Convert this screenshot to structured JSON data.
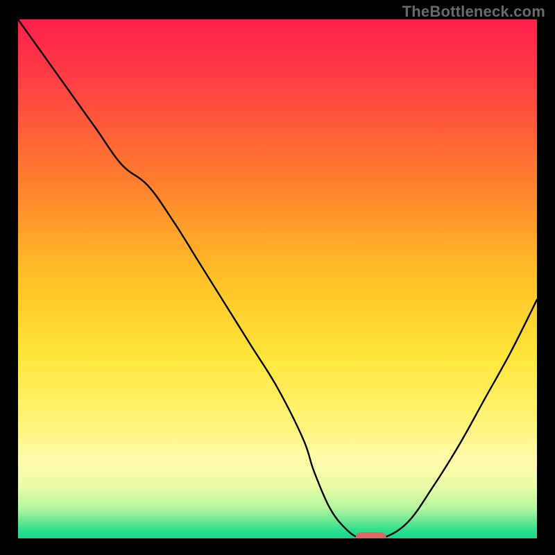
{
  "watermark": "TheBottleneck.com",
  "chart_data": {
    "type": "line",
    "title": "",
    "xlabel": "",
    "ylabel": "",
    "xlim": [
      0,
      100
    ],
    "ylim": [
      0,
      100
    ],
    "grid": false,
    "legend": false,
    "series": [
      {
        "name": "bottleneck-curve",
        "x": [
          0,
          5,
          10,
          15,
          20,
          25,
          30,
          35,
          40,
          45,
          50,
          55,
          57,
          60,
          63,
          66,
          70,
          75,
          80,
          85,
          90,
          95,
          100
        ],
        "y": [
          100,
          93,
          86,
          79,
          72,
          68,
          61,
          53,
          45,
          37,
          29,
          19,
          13,
          6,
          2,
          0,
          0,
          3,
          10,
          18,
          27,
          36,
          46
        ]
      }
    ],
    "marker": {
      "name": "optimal-point",
      "x": 68,
      "y": 0,
      "color": "#e06666",
      "width": 6,
      "height": 2.4
    },
    "background_gradient": {
      "stops": [
        {
          "offset": 0.0,
          "color": "#ff1f4b"
        },
        {
          "offset": 0.1,
          "color": "#ff3a46"
        },
        {
          "offset": 0.3,
          "color": "#ff7a2f"
        },
        {
          "offset": 0.5,
          "color": "#ffc226"
        },
        {
          "offset": 0.65,
          "color": "#ffe63a"
        },
        {
          "offset": 0.78,
          "color": "#fff57a"
        },
        {
          "offset": 0.85,
          "color": "#fffbac"
        },
        {
          "offset": 0.9,
          "color": "#e8fca6"
        },
        {
          "offset": 0.94,
          "color": "#b7f7a0"
        },
        {
          "offset": 0.965,
          "color": "#6fe895"
        },
        {
          "offset": 0.985,
          "color": "#2adf8d"
        },
        {
          "offset": 1.0,
          "color": "#17d98a"
        }
      ]
    }
  }
}
